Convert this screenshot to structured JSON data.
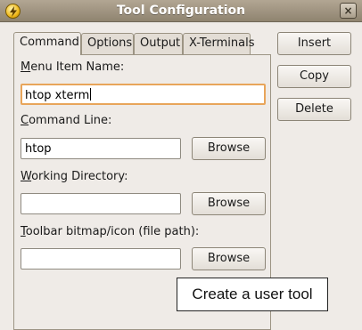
{
  "window": {
    "title": "Tool Configuration",
    "close_glyph": "×"
  },
  "tabs": [
    {
      "label": "Command",
      "active": true
    },
    {
      "label": "Options",
      "active": false
    },
    {
      "label": "Output",
      "active": false
    },
    {
      "label": "X-Terminals",
      "active": false
    }
  ],
  "form": {
    "menu_item_name": {
      "label_mnemonic": "M",
      "label_rest": "enu Item Name:",
      "value": "htop xterm"
    },
    "command_line": {
      "label_mnemonic": "C",
      "label_rest": "ommand Line:",
      "value": "htop",
      "browse_label": "Browse"
    },
    "working_directory": {
      "label_mnemonic": "W",
      "label_rest": "orking Directory:",
      "value": "",
      "browse_label": "Browse"
    },
    "toolbar_icon": {
      "label_mnemonic": "T",
      "label_rest": "oolbar bitmap/icon (file path):",
      "value": "",
      "browse_label": "Browse"
    }
  },
  "side_buttons": {
    "insert": "Insert",
    "copy": "Copy",
    "delete": "Delete"
  },
  "tooltip": {
    "text": "Create a user tool"
  }
}
